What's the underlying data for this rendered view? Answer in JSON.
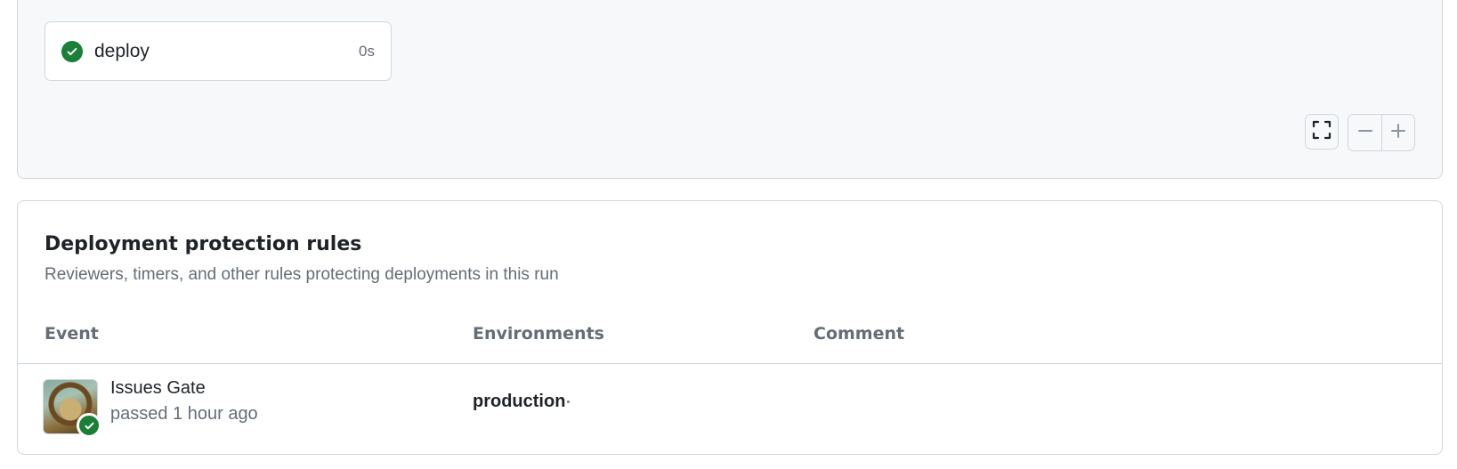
{
  "graph": {
    "job": {
      "name": "deploy",
      "duration": "0s",
      "status_icon": "check-circle-icon"
    },
    "controls": {
      "fullscreen_icon": "fullscreen-icon",
      "zoom_out_icon": "minus-icon",
      "zoom_in_icon": "plus-icon"
    }
  },
  "protection_rules": {
    "title": "Deployment protection rules",
    "subtitle": "Reviewers, timers, and other rules protecting deployments in this run",
    "columns": {
      "event": "Event",
      "environments": "Environments",
      "comment": "Comment"
    },
    "rows": [
      {
        "event_name": "Issues Gate",
        "event_status": "passed 1 hour ago",
        "environment": "production",
        "comment": ""
      }
    ]
  },
  "colors": {
    "success": "#1a7f37",
    "border": "#d0d7de",
    "muted_text": "#656d76",
    "panel_bg": "#f6f8fa"
  }
}
